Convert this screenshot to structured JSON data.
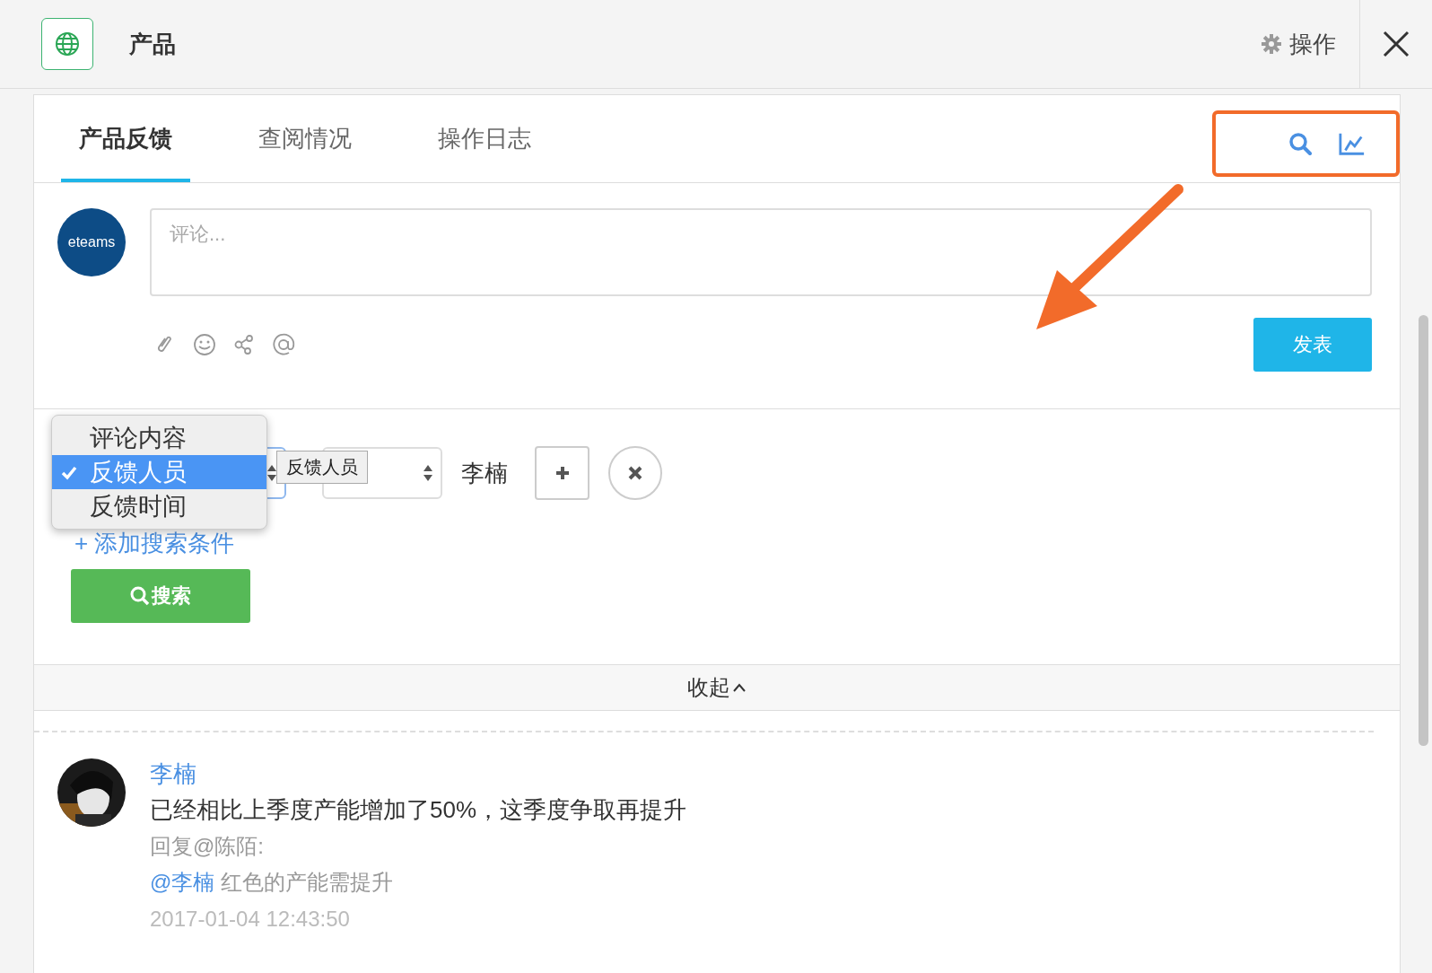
{
  "header": {
    "title": "产品",
    "action": "操作"
  },
  "tabs": [
    {
      "label": "产品反馈",
      "selected": true
    },
    {
      "label": "查阅情况",
      "selected": false
    },
    {
      "label": "操作日志",
      "selected": false
    }
  ],
  "composer": {
    "avatar_text": "eteams",
    "placeholder": "评论...",
    "submit": "发表"
  },
  "search": {
    "field_menu": [
      {
        "label": "评论内容",
        "selected": false
      },
      {
        "label": "反馈人员",
        "selected": true
      },
      {
        "label": "反馈时间",
        "selected": false
      }
    ],
    "tooltip": "反馈人员",
    "value": "李楠",
    "add_condition": "+ 添加搜索条件",
    "search_button": "搜索"
  },
  "collapse": "收起",
  "comments": [
    {
      "author": "李楠",
      "text": "已经相比上季度产能增加了50%，这季度争取再提升",
      "reply_label": "回复@陈陌:",
      "mention": "@李楠",
      "reply_text": "红色的产能需提升",
      "time": "2017-01-04 12:43:50"
    }
  ]
}
